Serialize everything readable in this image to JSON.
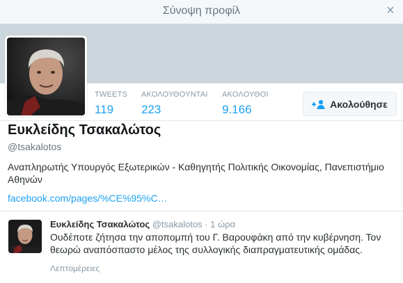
{
  "modal": {
    "title": "Σύνοψη προφίλ",
    "close_glyph": "×"
  },
  "profile": {
    "full_name": "Ευκλείδης Τσακαλώτος",
    "handle": "@tsakalotos",
    "bio": "Αναπληρωτής Υπουργός Εξωτερικών - Καθηγητής Πολιτικής Οικονομίας, Πανεπιστήμιο Αθηνών",
    "link": "facebook.com/pages/%CE%95%C…"
  },
  "stats": [
    {
      "label": "TWEETS",
      "value": "119"
    },
    {
      "label": "ΑΚΟΛΟΥΘΟΥΝΤΑΙ",
      "value": "223"
    },
    {
      "label": "ΑΚΟΛΟΥΘΟΙ",
      "value": "9.166"
    }
  ],
  "follow_button": {
    "label": "Ακολούθησε",
    "icon": "add-user-icon"
  },
  "tweet": {
    "name": "Ευκλείδης Τσακαλώτος",
    "handle": "@tsakalotos",
    "separator": "·",
    "time": "1 ώρα",
    "text": "Ουδέποτε ζήτησα την αποπομπή του Γ. Βαρουφάκη από την κυβέρνηση. Τον θεωρώ αναπόσπαστο μέλος της συλλογικής διαπραγματευτικής ομάδας.",
    "details_label": "Λεπτομέρειες"
  },
  "colors": {
    "accent": "#1da1f2",
    "banner": "#ccd6dd",
    "header_bg": "#f5f8fa"
  }
}
